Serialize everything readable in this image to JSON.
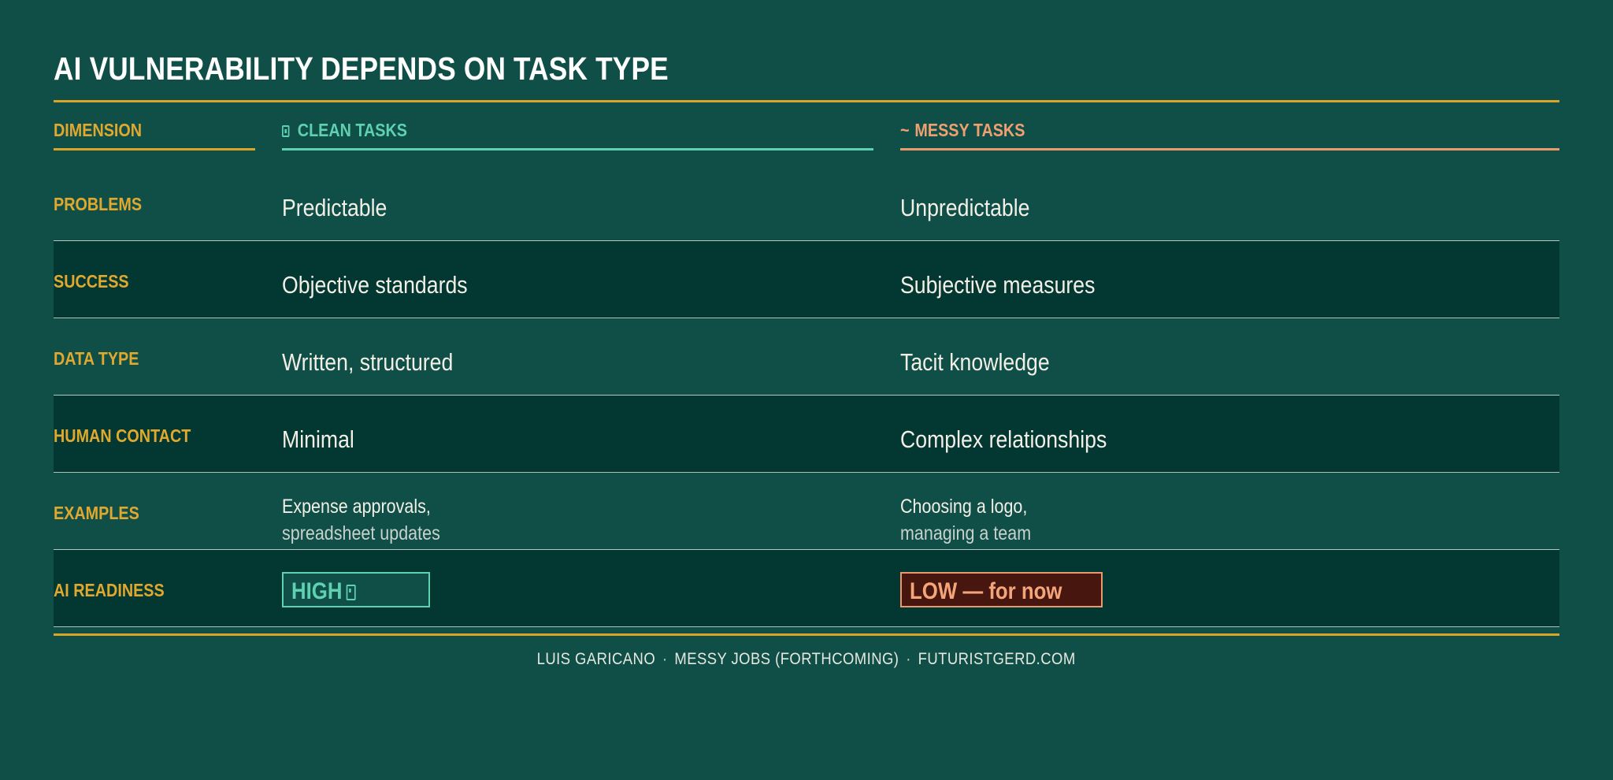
{
  "title": "AI VULNERABILITY DEPENDS ON TASK TYPE",
  "headers": {
    "dimension": "DIMENSION",
    "clean": {
      "icon": "square-check-icon",
      "label": "CLEAN TASKS"
    },
    "messy": {
      "symbol": "~",
      "label": "MESSY TASKS"
    }
  },
  "rows": [
    {
      "dimension": "PROBLEMS",
      "clean": "Predictable",
      "messy": "Unpredictable"
    },
    {
      "dimension": "SUCCESS",
      "clean": "Objective standards",
      "messy": "Subjective measures"
    },
    {
      "dimension": "DATA TYPE",
      "clean": "Written, structured",
      "messy": "Tacit knowledge"
    },
    {
      "dimension": "HUMAN CONTACT",
      "clean": "Minimal",
      "messy": "Complex relationships"
    },
    {
      "dimension": "EXAMPLES",
      "clean_lines": [
        "Expense approvals,",
        "spreadsheet updates"
      ],
      "messy_lines": [
        "Choosing a logo,",
        "managing a team"
      ]
    },
    {
      "dimension": "AI READINESS",
      "clean_badge": "HIGH",
      "messy_badge": "LOW — for now"
    }
  ],
  "footer": {
    "author": "LUIS GARICANO",
    "source": "MESSY JOBS (FORTHCOMING)",
    "site": "FUTURISTGERD.COM",
    "separator": "·"
  },
  "colors": {
    "background": "#0f4f48",
    "row_dark": "#033732",
    "gold": "#d9a42a",
    "clean": "#5fd0b0",
    "messy": "#e89a6c",
    "low_badge_bg": "#46160f"
  }
}
